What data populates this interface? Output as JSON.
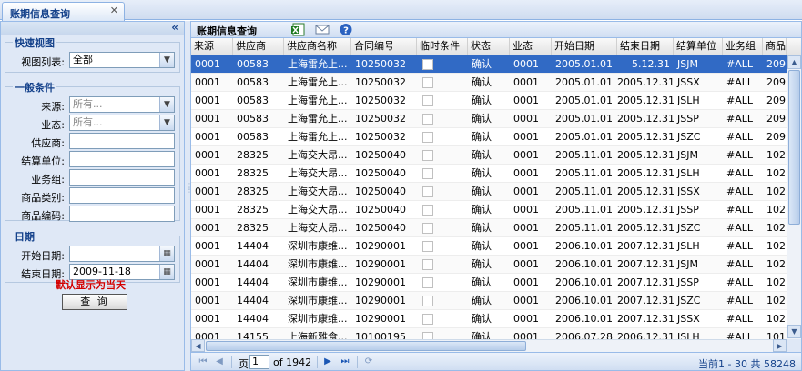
{
  "tab": {
    "title": "账期信息查询",
    "close": "✕"
  },
  "left": {
    "collapse": "«",
    "quick_view": {
      "legend": "快速视图",
      "view_list_label": "视图列表:",
      "view_list_value": "全部"
    },
    "general": {
      "legend": "一般条件",
      "source_label": "来源:",
      "source_placeholder": "所有...",
      "format_label": "业态:",
      "format_placeholder": "所有...",
      "supplier_label": "供应商:",
      "settle_unit_label": "结算单位:",
      "biz_group_label": "业务组:",
      "category_label": "商品类别:",
      "product_code_label": "商品编码:"
    },
    "date": {
      "legend": "日期",
      "start_label": "开始日期:",
      "start_value": "",
      "end_label": "结束日期:",
      "end_value": "2009-11-18",
      "default_note": "默认显示为当天"
    },
    "query_button": "查 询"
  },
  "grid": {
    "title": "账期信息查询",
    "icons": [
      "excel-export-icon",
      "mail-icon",
      "help-icon"
    ],
    "columns": [
      "来源",
      "供应商",
      "供应商名称",
      "合同编号",
      "临时条件",
      "状态",
      "业态",
      "开始日期",
      "结束日期",
      "结算单位",
      "业务组",
      "商品"
    ],
    "rows": [
      [
        "0001",
        "00583",
        "上海雷允上...",
        "10250032",
        "",
        "确认",
        "0001",
        "2005.01.01",
        "5.12.31",
        "JSJM",
        "#ALL",
        "209"
      ],
      [
        "0001",
        "00583",
        "上海雷允上...",
        "10250032",
        "",
        "确认",
        "0001",
        "2005.01.01",
        "2005.12.31",
        "JSSX",
        "#ALL",
        "209"
      ],
      [
        "0001",
        "00583",
        "上海雷允上...",
        "10250032",
        "",
        "确认",
        "0001",
        "2005.01.01",
        "2005.12.31",
        "JSLH",
        "#ALL",
        "209"
      ],
      [
        "0001",
        "00583",
        "上海雷允上...",
        "10250032",
        "",
        "确认",
        "0001",
        "2005.01.01",
        "2005.12.31",
        "JSSP",
        "#ALL",
        "209"
      ],
      [
        "0001",
        "00583",
        "上海雷允上...",
        "10250032",
        "",
        "确认",
        "0001",
        "2005.01.01",
        "2005.12.31",
        "JSZC",
        "#ALL",
        "209"
      ],
      [
        "0001",
        "28325",
        "上海交大昂...",
        "10250040",
        "",
        "确认",
        "0001",
        "2005.11.01",
        "2005.12.31",
        "JSJM",
        "#ALL",
        "102"
      ],
      [
        "0001",
        "28325",
        "上海交大昂...",
        "10250040",
        "",
        "确认",
        "0001",
        "2005.11.01",
        "2005.12.31",
        "JSLH",
        "#ALL",
        "102"
      ],
      [
        "0001",
        "28325",
        "上海交大昂...",
        "10250040",
        "",
        "确认",
        "0001",
        "2005.11.01",
        "2005.12.31",
        "JSSX",
        "#ALL",
        "102"
      ],
      [
        "0001",
        "28325",
        "上海交大昂...",
        "10250040",
        "",
        "确认",
        "0001",
        "2005.11.01",
        "2005.12.31",
        "JSSP",
        "#ALL",
        "102"
      ],
      [
        "0001",
        "28325",
        "上海交大昂...",
        "10250040",
        "",
        "确认",
        "0001",
        "2005.11.01",
        "2005.12.31",
        "JSZC",
        "#ALL",
        "102"
      ],
      [
        "0001",
        "14404",
        "深圳市康维...",
        "10290001",
        "",
        "确认",
        "0001",
        "2006.10.01",
        "2007.12.31",
        "JSLH",
        "#ALL",
        "102"
      ],
      [
        "0001",
        "14404",
        "深圳市康维...",
        "10290001",
        "",
        "确认",
        "0001",
        "2006.10.01",
        "2007.12.31",
        "JSJM",
        "#ALL",
        "102"
      ],
      [
        "0001",
        "14404",
        "深圳市康维...",
        "10290001",
        "",
        "确认",
        "0001",
        "2006.10.01",
        "2007.12.31",
        "JSSP",
        "#ALL",
        "102"
      ],
      [
        "0001",
        "14404",
        "深圳市康维...",
        "10290001",
        "",
        "确认",
        "0001",
        "2006.10.01",
        "2007.12.31",
        "JSZC",
        "#ALL",
        "102"
      ],
      [
        "0001",
        "14404",
        "深圳市康维...",
        "10290001",
        "",
        "确认",
        "0001",
        "2006.10.01",
        "2007.12.31",
        "JSSX",
        "#ALL",
        "102"
      ],
      [
        "0001",
        "14155",
        "上海新雅食...",
        "10100195",
        "",
        "确认",
        "0001",
        "2006.07.28",
        "2006.12.31",
        "JSLH",
        "#ALL",
        "101"
      ]
    ],
    "selected_row": 0
  },
  "pager": {
    "page_label": "页",
    "page_value": "1",
    "of_label": "of 1942",
    "info": "当前1 - 30 共 58248"
  },
  "colors": {
    "accent": "#15428b",
    "selection": "#316ac5",
    "note": "#d40000"
  }
}
